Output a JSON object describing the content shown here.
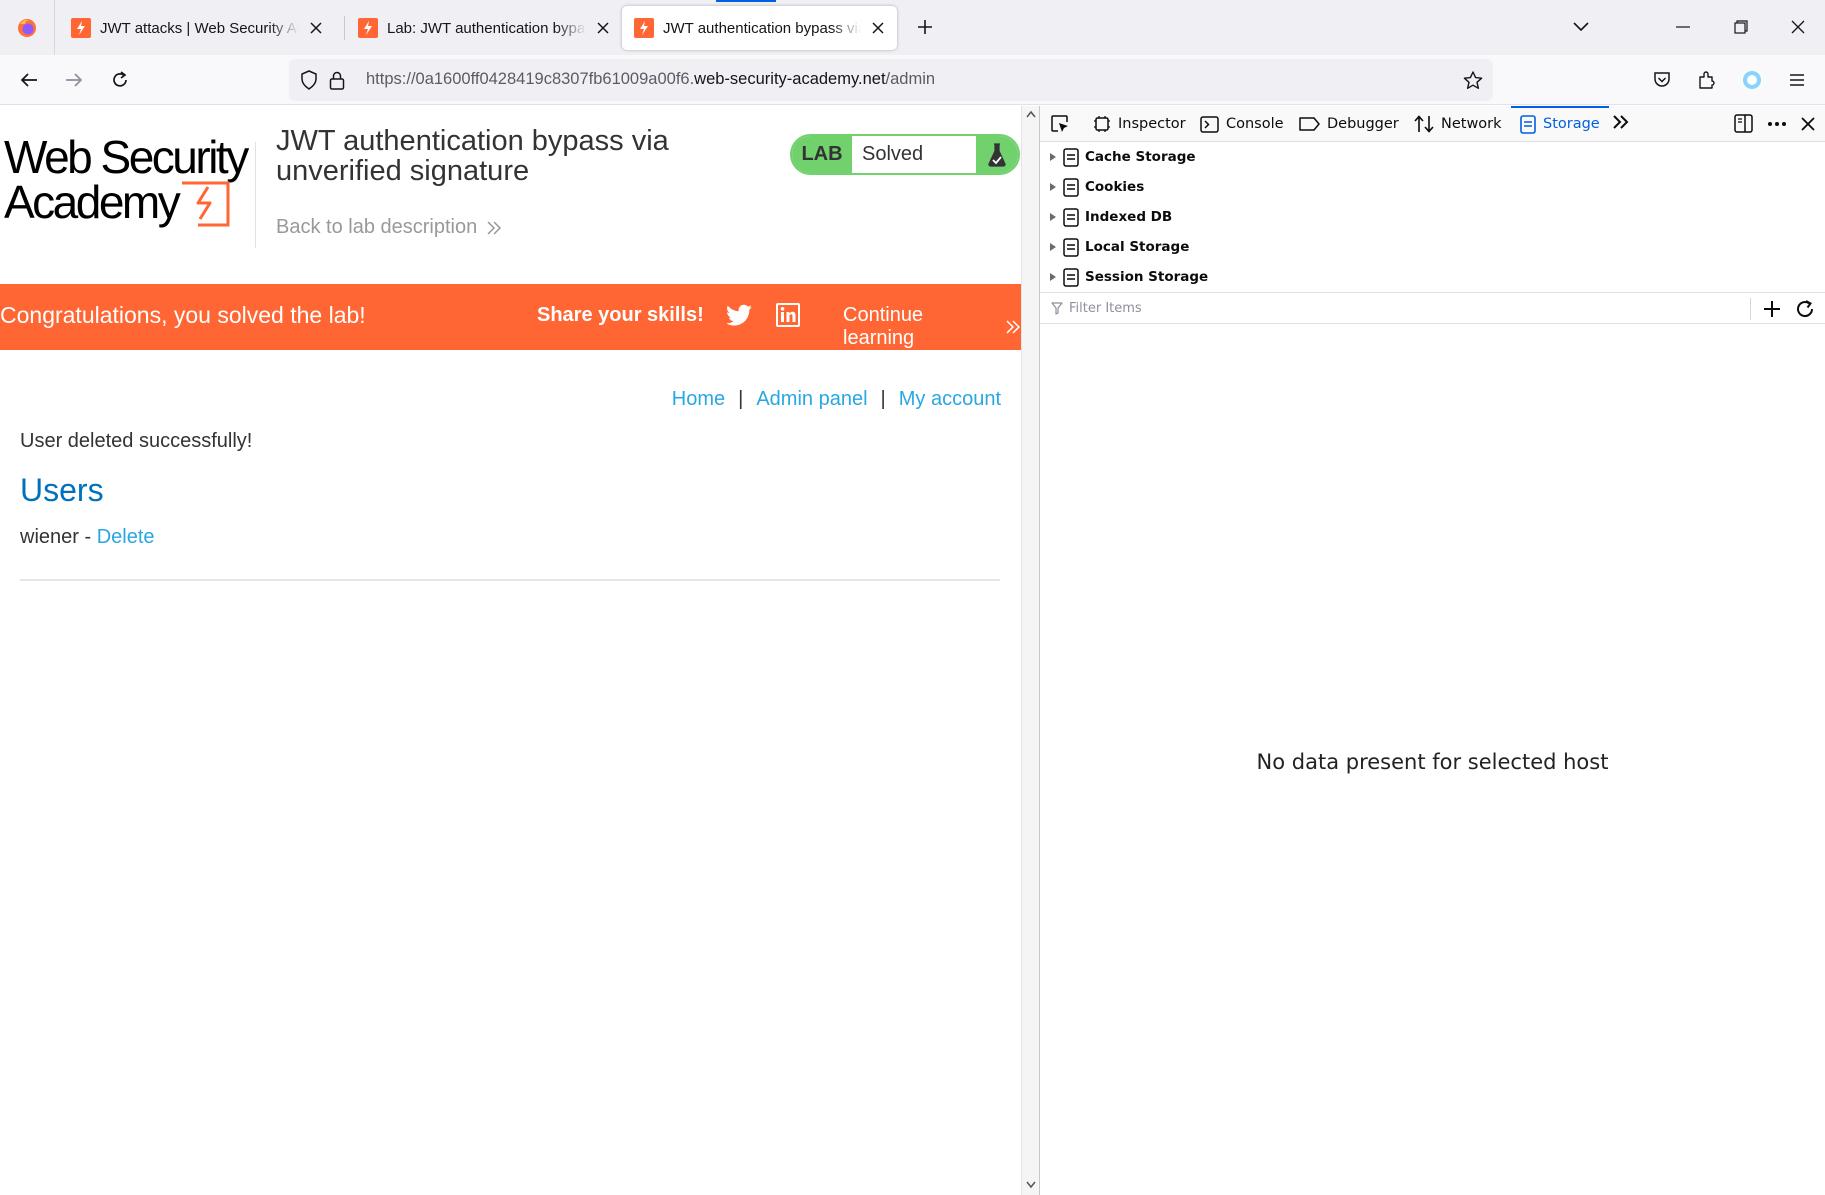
{
  "browser": {
    "tabs": [
      {
        "title": "JWT attacks | Web Security Academy",
        "active": false
      },
      {
        "title": "Lab: JWT authentication bypass via unverified signature",
        "active": false
      },
      {
        "title": "JWT authentication bypass via unverified signature",
        "active": true
      }
    ],
    "url": {
      "prefix": "https://0a1600ff0428419c8307fb61009a00f6.",
      "host": "web-security-academy.net",
      "path": "/admin"
    }
  },
  "page": {
    "logo_text": "Web Security Academy",
    "lab_title": "JWT authentication bypass via unverified signature",
    "back_link": "Back to lab description",
    "badge": {
      "label": "LAB",
      "status": "Solved"
    },
    "banner": {
      "congrats": "Congratulations, you solved the lab!",
      "share": "Share your skills!",
      "continue": "Continue learning"
    },
    "nav": {
      "home": "Home",
      "admin": "Admin panel",
      "account": "My account",
      "separator": "|"
    },
    "message": "User deleted successfully!",
    "users_heading": "Users",
    "user": {
      "name": "wiener",
      "dash": " - ",
      "action": "Delete"
    }
  },
  "devtools": {
    "tabs": [
      "Inspector",
      "Console",
      "Debugger",
      "Network",
      "Storage"
    ],
    "selected_tab": "Storage",
    "tree": [
      "Cache Storage",
      "Cookies",
      "Indexed DB",
      "Local Storage",
      "Session Storage"
    ],
    "filter_placeholder": "Filter Items",
    "empty_message": "No data present for selected host"
  },
  "colors": {
    "brand_orange": "#ff6633",
    "lab_green": "#70d16d",
    "link_blue": "#29a7e2",
    "heading_blue": "#0071bc",
    "devtools_selected": "#0060df"
  }
}
